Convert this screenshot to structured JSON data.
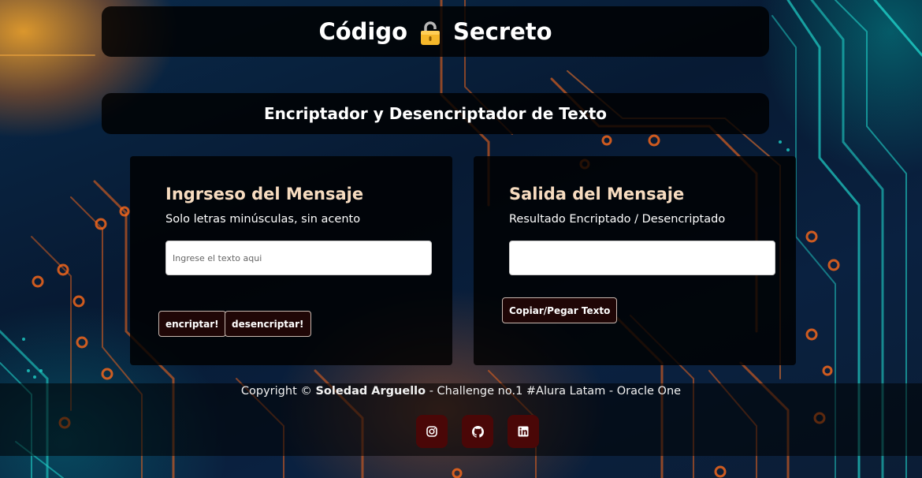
{
  "header": {
    "title_left": "Código",
    "title_right": "Secreto",
    "lock_icon": "lock-icon"
  },
  "subtitle": "Encriptador y Desencriptador de Texto",
  "input_panel": {
    "heading": "Ingrseso del Mensaje",
    "hint": "Solo letras minúsculas, sin acento",
    "field_value": "",
    "field_placeholder": "Ingrese el texto aqui",
    "encrypt_label": "encriptar!",
    "decrypt_label": "desencriptar!"
  },
  "output_panel": {
    "heading": "Salida del Mensaje",
    "hint": "Resultado Encriptado / Desencriptado",
    "field_value": "",
    "copy_label": "Copiar/Pegar Texto"
  },
  "footer": {
    "prefix": "Copyright © ",
    "author": "Soledad Arguello",
    "suffix": " - Challenge no.1 #Alura Latam - Oracle One",
    "social": [
      "instagram-icon",
      "github-icon",
      "linkedin-icon"
    ]
  },
  "colors": {
    "panel_bg": "#000000",
    "heading": "#f7dcc0",
    "button_bg": "#1f0606",
    "social_bg": "#4a0707",
    "circuit_orange": "#ff6a1a",
    "circuit_teal": "#1fd0c8"
  }
}
